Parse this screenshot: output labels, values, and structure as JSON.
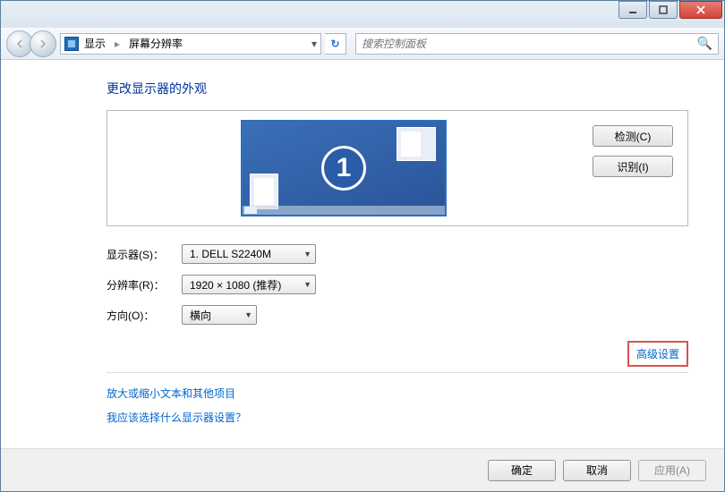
{
  "breadcrumb": {
    "root": "显示",
    "current": "屏幕分辨率"
  },
  "search": {
    "placeholder": "搜索控制面板"
  },
  "page": {
    "title": "更改显示器的外观"
  },
  "monitor": {
    "number": "1",
    "detect_btn": "检测(C)",
    "identify_btn": "识别(I)"
  },
  "form": {
    "display_label": "显示器(S)：",
    "display_value": "1. DELL S2240M",
    "resolution_label": "分辨率(R)：",
    "resolution_value": "1920 × 1080 (推荐)",
    "orientation_label": "方向(O)：",
    "orientation_value": "横向"
  },
  "advanced_link": "高级设置",
  "links": {
    "text_size": "放大或缩小文本和其他项目",
    "help": "我应该选择什么显示器设置？"
  },
  "buttons": {
    "ok": "确定",
    "cancel": "取消",
    "apply": "应用(A)"
  }
}
